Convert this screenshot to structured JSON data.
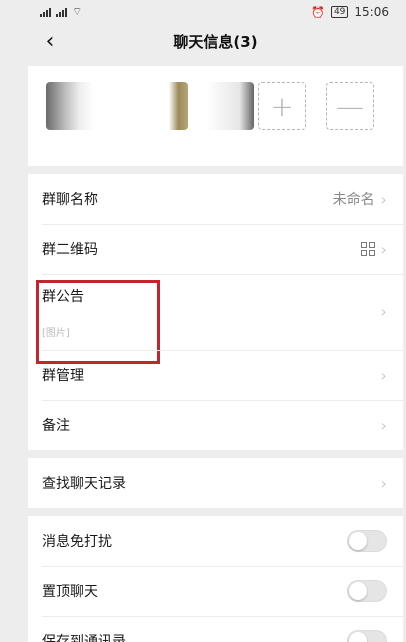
{
  "status_bar": {
    "left_info": "³ᴳ ⁴ᴳ",
    "battery": "49",
    "time": "15:06"
  },
  "nav": {
    "back_glyph": "‹",
    "title": "聊天信息(3)"
  },
  "members": {
    "add_glyph": "+",
    "remove_glyph": "—"
  },
  "rows": {
    "group_name": {
      "label": "群聊名称",
      "value": "未命名"
    },
    "qr_code": {
      "label": "群二维码"
    },
    "notice": {
      "label": "群公告",
      "sub": "[图片]"
    },
    "manage": {
      "label": "群管理"
    },
    "remark": {
      "label": "备注"
    },
    "search_history": {
      "label": "查找聊天记录"
    },
    "mute": {
      "label": "消息免打扰",
      "on": false
    },
    "pin": {
      "label": "置顶聊天",
      "on": false
    },
    "save_contacts": {
      "label": "保存到通讯录",
      "on": false
    }
  },
  "glyphs": {
    "chevron": "›"
  },
  "colors": {
    "highlight": "#c0272d",
    "background": "#ededed"
  }
}
